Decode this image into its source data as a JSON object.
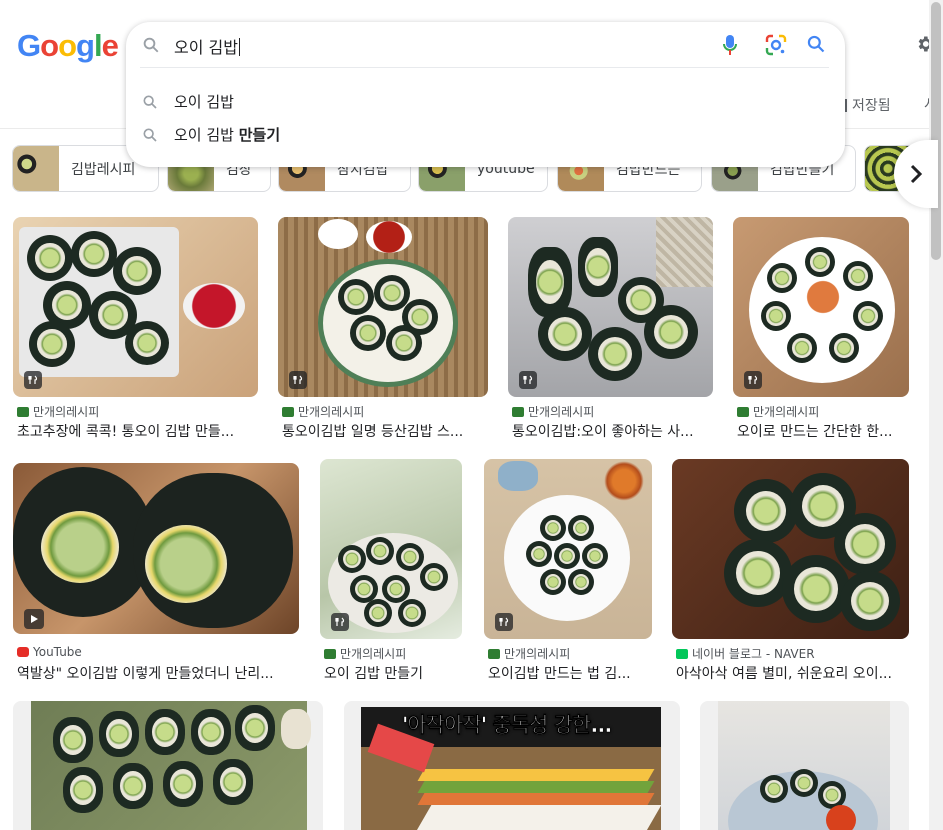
{
  "logo": "Google",
  "search": {
    "query": "오이 김밥",
    "suggestions": [
      {
        "base": "오이 김밥",
        "bold": ""
      },
      {
        "base": "오이 김밥 ",
        "bold": "만들기"
      }
    ]
  },
  "header": {
    "saved_label": "저장됨",
    "more_cut": "시"
  },
  "chips": [
    {
      "label": "김밥레시피",
      "color": "#7a6a4a"
    },
    {
      "label": "김장",
      "color": "#6a7a3a"
    },
    {
      "label": "참치김밥",
      "color": "#7a5a3a"
    },
    {
      "label": "youtube",
      "color": "#6a7a5a"
    },
    {
      "label": "김밥만드는",
      "color": "#8a6a3a"
    },
    {
      "label": "김밥만들기",
      "color": "#5a6a4a"
    },
    {
      "label": "",
      "color": "#9aa04a"
    }
  ],
  "results": [
    {
      "source": "만개의레시피",
      "title": "초고추장에 콕콕! 통오이 김밥 만들...",
      "badge": "recipe-icon",
      "fav": "#2f7d32"
    },
    {
      "source": "만개의레시피",
      "title": "통오이김밥 일명 등산김밥 스...",
      "badge": "recipe-icon",
      "fav": "#2f7d32"
    },
    {
      "source": "만개의레시피",
      "title": "통오이김밥:오이 좋아하는 사...",
      "badge": "recipe-icon",
      "fav": "#2f7d32"
    },
    {
      "source": "만개의레시피",
      "title": "오이로 만드는 간단한 한...",
      "badge": "recipe-icon",
      "fav": "#2f7d32"
    },
    {
      "source": "YouTube",
      "title": "역발상\" 오이김밥 이렇게 만들었더니 난리...",
      "badge": "play-icon",
      "fav": "#e52d27"
    },
    {
      "source": "만개의레시피",
      "title": "오이 김밥 만들기",
      "badge": "recipe-icon",
      "fav": "#2f7d32"
    },
    {
      "source": "만개의레시피",
      "title": "오이김밥 만드는 법 김...",
      "badge": "recipe-icon",
      "fav": "#2f7d32"
    },
    {
      "source": "네이버 블로그 - NAVER",
      "title": "아삭아삭 여름 별미, 쉬운요리 오이...",
      "badge": "",
      "fav": "#03c75a"
    }
  ],
  "bottom": {
    "video_overlay_text": "'아작아작' 중독성 강한..."
  },
  "colors": {
    "blue": "#4285f4",
    "red": "#ea4335",
    "yellow": "#fbbc05",
    "green": "#34a853"
  }
}
